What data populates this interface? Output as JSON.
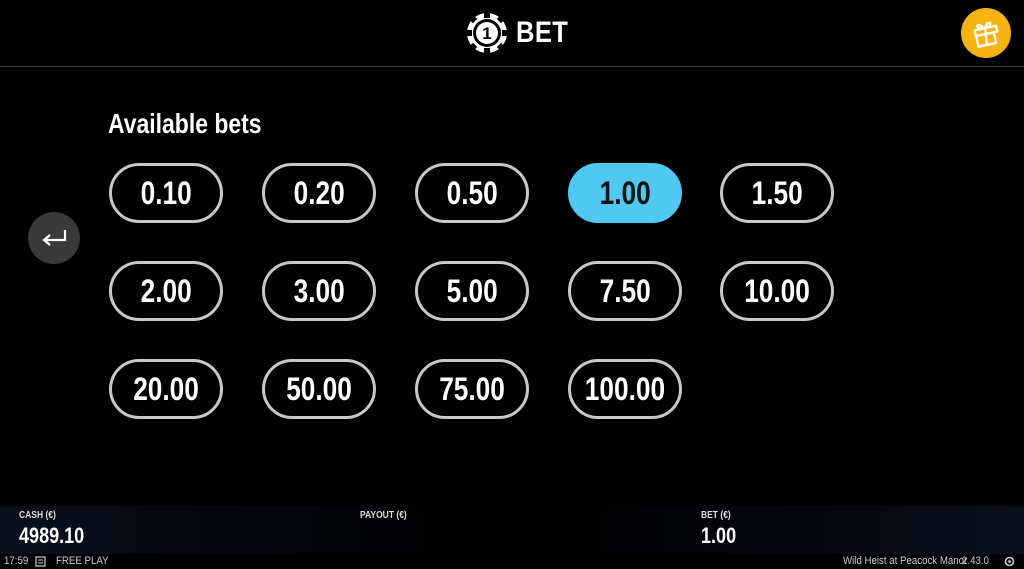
{
  "header": {
    "title": "BET",
    "chip_value": "1",
    "gift_icon": "gift-icon"
  },
  "back_icon": "return-arrow-icon",
  "section": {
    "title": "Available bets"
  },
  "bets": [
    {
      "label": "0.10"
    },
    {
      "label": "0.20"
    },
    {
      "label": "0.50"
    },
    {
      "label": "1.00"
    },
    {
      "label": "1.50"
    },
    {
      "label": "2.00"
    },
    {
      "label": "3.00"
    },
    {
      "label": "5.00"
    },
    {
      "label": "7.50"
    },
    {
      "label": "10.00"
    },
    {
      "label": "20.00"
    },
    {
      "label": "50.00"
    },
    {
      "label": "75.00"
    },
    {
      "label": "100.00"
    }
  ],
  "selected_bet": "1.00",
  "footer": {
    "cash_label": "CASH (€)",
    "cash_value": "4989.10",
    "payout_label": "PAYOUT (€)",
    "payout_value": "",
    "bet_label": "BET (€)",
    "bet_value": "1.00"
  },
  "statusbar": {
    "time": "17:59",
    "mode": "FREE PLAY",
    "game_name": "Wild Heist at Peacock Manor",
    "version": "2.43.0"
  },
  "colors": {
    "background": "#000000",
    "selected": "#4fc8f4",
    "gift": "#f6b414",
    "button_border": "#c8c8c8"
  }
}
